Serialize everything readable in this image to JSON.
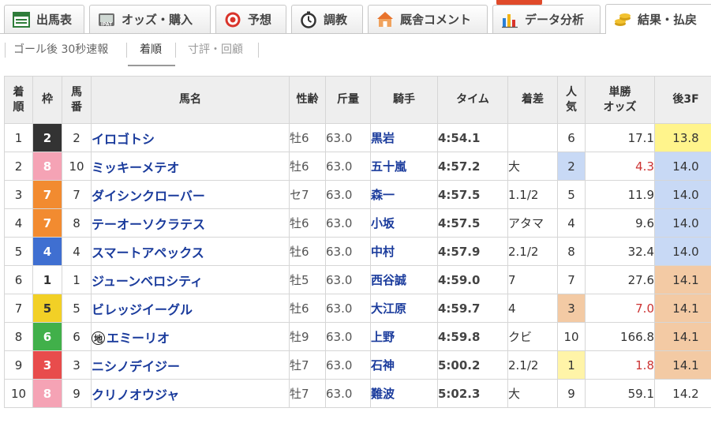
{
  "tabs": [
    {
      "label": "出馬表",
      "icon": "entry-table-icon"
    },
    {
      "label": "オッズ・購入",
      "icon": "ipat-icon"
    },
    {
      "label": "予想",
      "icon": "target-icon"
    },
    {
      "label": "調教",
      "icon": "stopwatch-icon"
    },
    {
      "label": "厩舎コメント",
      "icon": "stable-house-icon"
    },
    {
      "label": "データ分析",
      "icon": "bar-chart-icon"
    },
    {
      "label": "結果・払戻",
      "icon": "coins-icon"
    }
  ],
  "subtabs": [
    {
      "label": "ゴール後 30秒速報"
    },
    {
      "label": "着順"
    },
    {
      "label": "寸評・回顧"
    }
  ],
  "table": {
    "headers": {
      "rank": "着\n順",
      "waku": "枠",
      "umaban": "馬\n番",
      "name": "馬名",
      "sexage": "性齢",
      "weight": "斤量",
      "jockey": "騎手",
      "time": "タイム",
      "margin": "着差",
      "pop": "人\n気",
      "odds": "単勝\nオッズ",
      "last3f": "後3F"
    },
    "colors": {
      "waku": {
        "1": "#ffffff",
        "2": "#333333",
        "3": "#e84c4c",
        "4": "#3f6fd1",
        "5": "#f2d026",
        "6": "#41b04a",
        "7": "#f28b30",
        "8": "#f5a3b5"
      },
      "pop_highlight": {
        "1": "#fff4a8",
        "2": "#c8d9f5",
        "3": "#f3caa4"
      },
      "f3_gold": "#fff48c",
      "f3_blue": "#c8d9f5",
      "f3_orange": "#f3caa4",
      "odds_red": "#cc3333"
    },
    "chikoku_mark": "地",
    "rows": [
      {
        "rank": "1",
        "waku": "2",
        "umaban": "2",
        "name": "イロゴトシ",
        "sexage": "牡6",
        "weight": "63.0",
        "jockey": "黒岩",
        "time": "4:54.1",
        "margin": "",
        "pop": "6",
        "odds": "17.1",
        "last3f": "13.8",
        "f3": "gold",
        "chikoku": false
      },
      {
        "rank": "2",
        "waku": "8",
        "umaban": "10",
        "name": "ミッキーメテオ",
        "sexage": "牡6",
        "weight": "63.0",
        "jockey": "五十嵐",
        "time": "4:57.2",
        "margin": "大",
        "pop": "2",
        "odds": "4.3",
        "last3f": "14.0",
        "f3": "blue",
        "chikoku": false
      },
      {
        "rank": "3",
        "waku": "7",
        "umaban": "7",
        "name": "ダイシンクローバー",
        "sexage": "セ7",
        "weight": "63.0",
        "jockey": "森一",
        "time": "4:57.5",
        "margin": "1.1/2",
        "pop": "5",
        "odds": "11.9",
        "last3f": "14.0",
        "f3": "blue",
        "chikoku": false
      },
      {
        "rank": "4",
        "waku": "7",
        "umaban": "8",
        "name": "テーオーソクラテス",
        "sexage": "牡6",
        "weight": "63.0",
        "jockey": "小坂",
        "time": "4:57.5",
        "margin": "アタマ",
        "pop": "4",
        "odds": "9.6",
        "last3f": "14.0",
        "f3": "blue",
        "chikoku": false
      },
      {
        "rank": "5",
        "waku": "4",
        "umaban": "4",
        "name": "スマートアペックス",
        "sexage": "牡6",
        "weight": "63.0",
        "jockey": "中村",
        "time": "4:57.9",
        "margin": "2.1/2",
        "pop": "8",
        "odds": "32.4",
        "last3f": "14.0",
        "f3": "blue",
        "chikoku": false
      },
      {
        "rank": "6",
        "waku": "1",
        "umaban": "1",
        "name": "ジューンベロシティ",
        "sexage": "牡5",
        "weight": "63.0",
        "jockey": "西谷誠",
        "time": "4:59.0",
        "margin": "7",
        "pop": "7",
        "odds": "27.6",
        "last3f": "14.1",
        "f3": "orange",
        "chikoku": false
      },
      {
        "rank": "7",
        "waku": "5",
        "umaban": "5",
        "name": "ビレッジイーグル",
        "sexage": "牡6",
        "weight": "63.0",
        "jockey": "大江原",
        "time": "4:59.7",
        "margin": "4",
        "pop": "3",
        "odds": "7.0",
        "last3f": "14.1",
        "f3": "orange",
        "chikoku": false
      },
      {
        "rank": "8",
        "waku": "6",
        "umaban": "6",
        "name": "エミーリオ",
        "sexage": "牡9",
        "weight": "63.0",
        "jockey": "上野",
        "time": "4:59.8",
        "margin": "クビ",
        "pop": "10",
        "odds": "166.8",
        "last3f": "14.1",
        "f3": "orange",
        "chikoku": true
      },
      {
        "rank": "9",
        "waku": "3",
        "umaban": "3",
        "name": "ニシノデイジー",
        "sexage": "牡7",
        "weight": "63.0",
        "jockey": "石神",
        "time": "5:00.2",
        "margin": "2.1/2",
        "pop": "1",
        "odds": "1.8",
        "last3f": "14.1",
        "f3": "orange",
        "chikoku": false
      },
      {
        "rank": "10",
        "waku": "8",
        "umaban": "9",
        "name": "クリノオウジャ",
        "sexage": "牡7",
        "weight": "63.0",
        "jockey": "難波",
        "time": "5:02.3",
        "margin": "大",
        "pop": "9",
        "odds": "59.1",
        "last3f": "14.2",
        "f3": "none",
        "chikoku": false
      }
    ]
  }
}
